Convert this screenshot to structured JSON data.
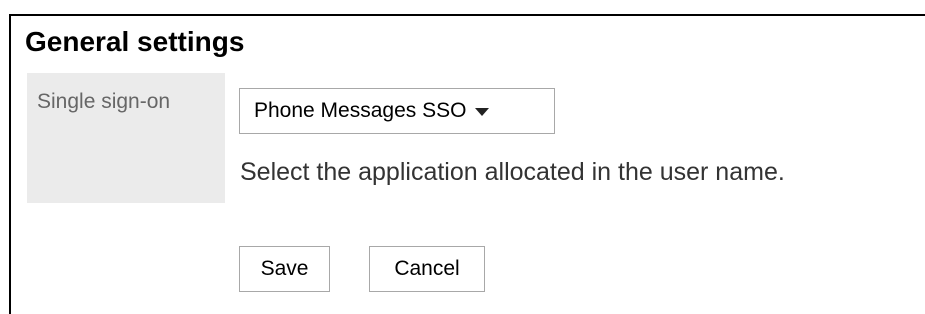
{
  "page": {
    "title": "General settings"
  },
  "form": {
    "sso_label": "Single sign-on",
    "sso_select": {
      "selected": "Phone Messages SSO",
      "caret_icon": "chevron-down-icon"
    },
    "hint": "Select the application allocated in the user name."
  },
  "actions": {
    "save_label": "Save",
    "cancel_label": "Cancel"
  }
}
